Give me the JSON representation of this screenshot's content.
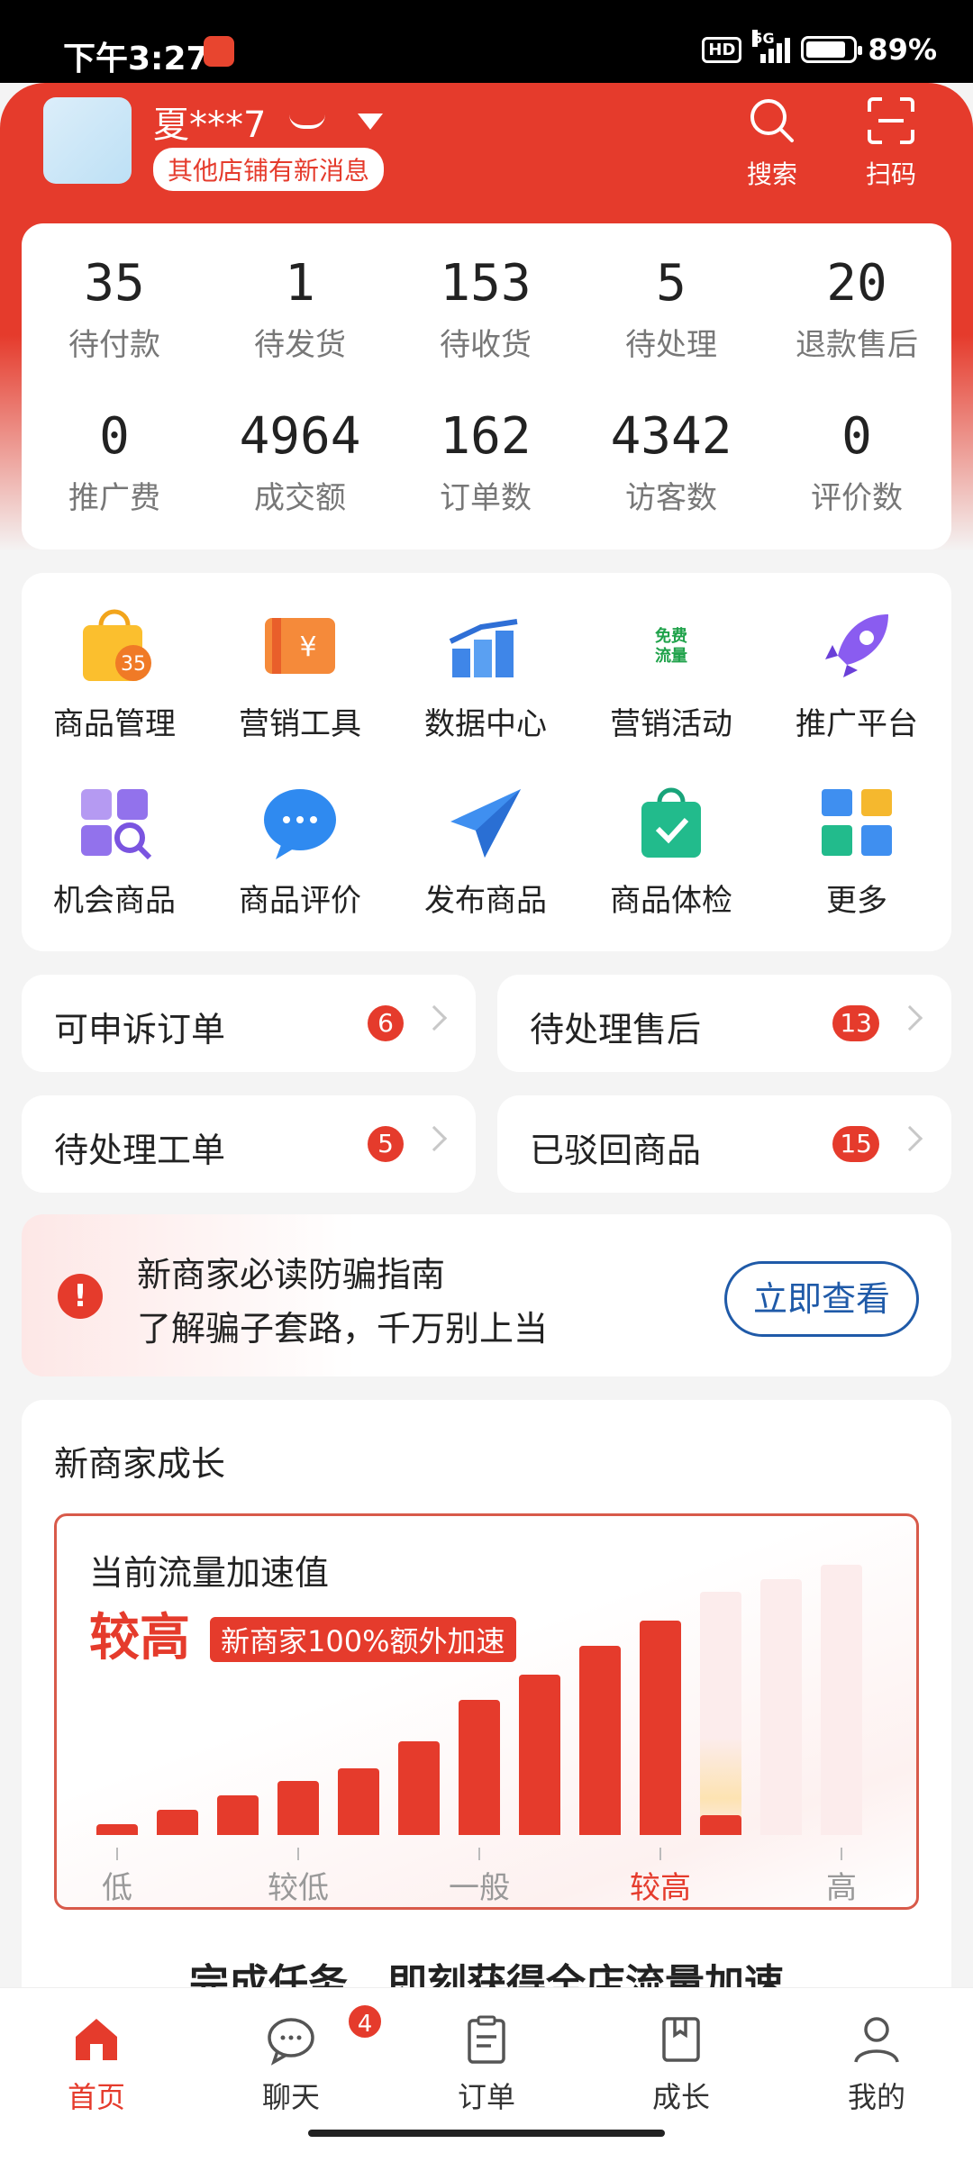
{
  "status_bar": {
    "time": "下午3:27",
    "hd": "HD",
    "network": "5G",
    "battery": "89%"
  },
  "header": {
    "username": "夏***7",
    "new_message_badge": "其他店铺有新消息",
    "search_label": "搜索",
    "scan_label": "扫码"
  },
  "stats": [
    {
      "value": "35",
      "label": "待付款"
    },
    {
      "value": "1",
      "label": "待发货"
    },
    {
      "value": "153",
      "label": "待收货"
    },
    {
      "value": "5",
      "label": "待处理"
    },
    {
      "value": "20",
      "label": "退款售后"
    },
    {
      "value": "0",
      "label": "推广费"
    },
    {
      "value": "4964",
      "label": "成交额"
    },
    {
      "value": "162",
      "label": "订单数"
    },
    {
      "value": "4342",
      "label": "访客数"
    },
    {
      "value": "0",
      "label": "评价数"
    }
  ],
  "tools": [
    {
      "label": "商品管理",
      "icon": "shopping-bag-icon",
      "icon_text": "35"
    },
    {
      "label": "营销工具",
      "icon": "coupon-icon",
      "icon_text": "¥"
    },
    {
      "label": "数据中心",
      "icon": "bar-chart-icon"
    },
    {
      "label": "营销活动",
      "icon": "free-traffic-icon",
      "icon_text": "免费\n流量"
    },
    {
      "label": "推广平台",
      "icon": "rocket-icon"
    },
    {
      "label": "机会商品",
      "icon": "grid-search-icon"
    },
    {
      "label": "商品评价",
      "icon": "chat-bubble-icon"
    },
    {
      "label": "发布商品",
      "icon": "paper-plane-icon"
    },
    {
      "label": "商品体检",
      "icon": "checked-bag-icon"
    },
    {
      "label": "更多",
      "icon": "more-apps-icon"
    }
  ],
  "quick_links": [
    {
      "label": "可申诉订单",
      "count": "6"
    },
    {
      "label": "待处理售后",
      "count": "13"
    },
    {
      "label": "待处理工单",
      "count": "5"
    },
    {
      "label": "已驳回商品",
      "count": "15"
    }
  ],
  "notice": {
    "title": "新商家必读防骗指南",
    "subtitle": "了解骗子套路，千万别上当",
    "button": "立即查看"
  },
  "growth": {
    "title": "新商家成长",
    "box_title": "当前流量加速值",
    "level": "较高",
    "tag": "新商家100%额外加速",
    "axis_labels": [
      "低",
      "较低",
      "一般",
      "较高",
      "高"
    ],
    "current_axis_index": 3,
    "footer_partial": "完成任务，即刻获得全店流量加速"
  },
  "tabs": [
    {
      "label": "首页",
      "icon": "home-icon",
      "active": true
    },
    {
      "label": "聊天",
      "icon": "chat-icon",
      "badge": "4"
    },
    {
      "label": "订单",
      "icon": "order-icon"
    },
    {
      "label": "成长",
      "icon": "book-icon"
    },
    {
      "label": "我的",
      "icon": "person-icon"
    }
  ],
  "colors": {
    "brand": "#e53b2c",
    "link": "#1f5aa8"
  }
}
